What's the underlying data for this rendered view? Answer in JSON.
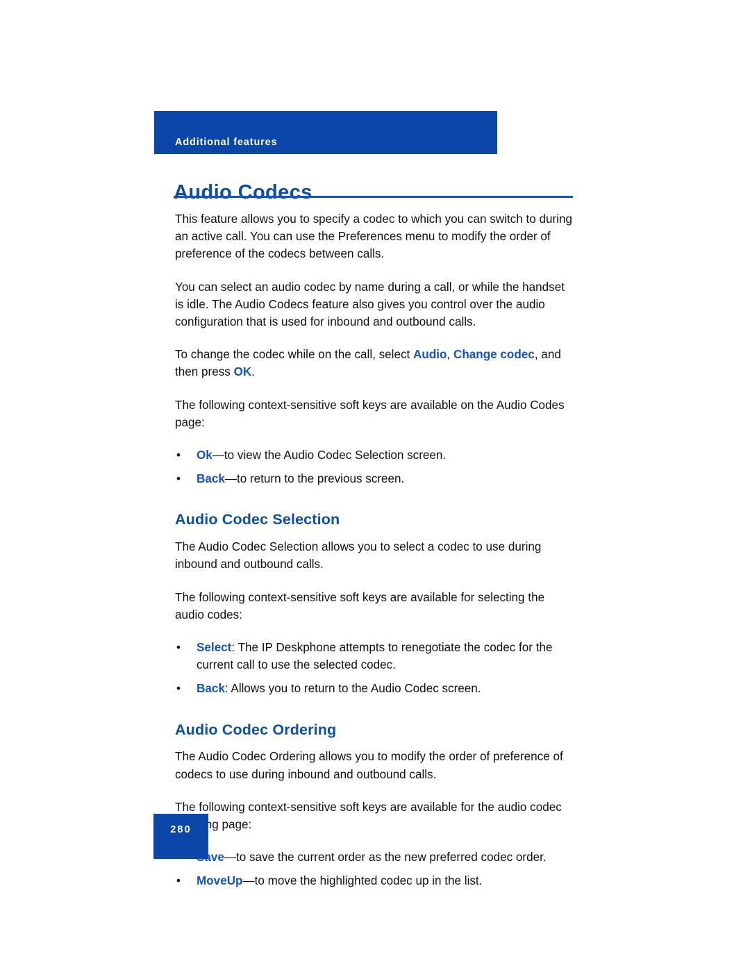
{
  "document": {
    "running_header": "Additional features",
    "page_number": "280",
    "chapter_title": "Audio Codecs",
    "colors": {
      "brand_blue": "#0A47A8",
      "heading_blue": "#0D4FA8",
      "keyword_blue": "#1352C8",
      "body_text": "#111111",
      "page_background": "#ffffff"
    }
  },
  "body": {
    "paragraph_1": "This feature allows you to specify a codec to which you can switch to during an active call. You can use the Preferences menu to modify the order of preference of the codecs between calls.",
    "paragraph_2": "You can select an audio codec by name during a call, or while the handset is idle. The Audio Codecs feature also gives you control over the audio configuration that is used for inbound and outbound calls.",
    "paragraph_3": {
      "part_1": "To change the codec while on the call, select ",
      "keyword_1": "Audio",
      "part_2": ", ",
      "keyword_2": "Change codec",
      "part_3": ", and then press ",
      "keyword_3": "OK",
      "part_4": "."
    },
    "paragraph_4": "The following context-sensitive soft keys are available on the Audio Codes page:",
    "softkeys_audio_codes": [
      {
        "bullet": "•",
        "keyword": "Ok",
        "text": "—to view the Audio Codec Selection screen."
      },
      {
        "bullet": "•",
        "keyword": "Back",
        "text": "—to return to the previous screen."
      }
    ],
    "section_selection": {
      "heading": "Audio Codec Selection",
      "paragraph_1": "The Audio Codec Selection allows you to select a codec to use during inbound and outbound calls.",
      "paragraph_2": "The following context-sensitive soft keys are available for selecting the audio codes:",
      "softkeys": [
        {
          "bullet": "•",
          "keyword": "Select",
          "text": ": The IP Deskphone attempts to renegotiate the codec for the current call to use the selected codec."
        },
        {
          "bullet": "•",
          "keyword": "Back",
          "text": ": Allows you to return to the Audio Codec screen."
        }
      ]
    },
    "section_ordering": {
      "heading": "Audio Codec Ordering",
      "paragraph_1": "The Audio Codec Ordering allows you to modify the order of preference of codecs to use during inbound and outbound calls.",
      "paragraph_2": "The following context-sensitive soft keys are available for the audio codec ordering page:",
      "softkeys": [
        {
          "bullet": "•",
          "keyword": "Save",
          "text": "—to save the current order as the new preferred codec order."
        },
        {
          "bullet": "•",
          "keyword": "MoveUp",
          "text": "—to move the highlighted codec up in the list."
        }
      ]
    }
  }
}
